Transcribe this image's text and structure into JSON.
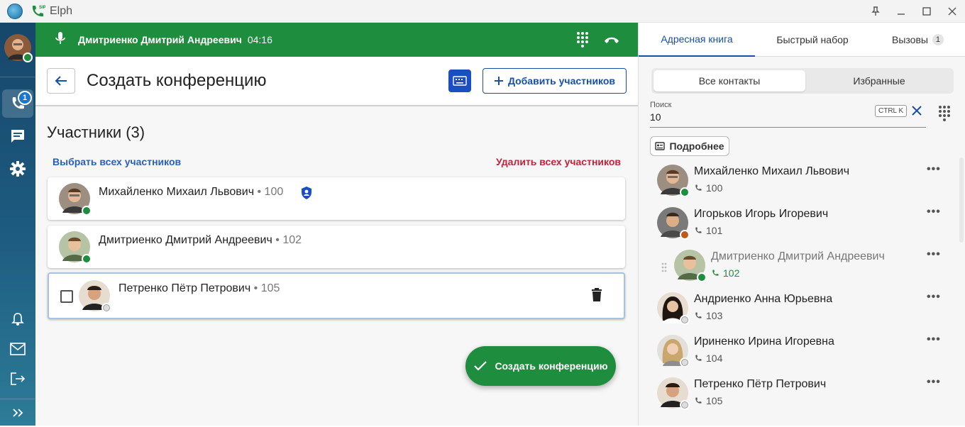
{
  "app": {
    "title": "Elph"
  },
  "rail": {
    "calls_badge": "1"
  },
  "call": {
    "caller": "Дмитриенко Дмитрий Андреевич",
    "timer": "04:16"
  },
  "header": {
    "title": "Создать конференцию",
    "add_label": "Добавить участников"
  },
  "participants": {
    "title": "Участники (3)",
    "select_all": "Выбрать всех участников",
    "delete_all": "Удалить всех участников",
    "items": [
      {
        "name": "Михайленко Михаил Львович",
        "sep": " • ",
        "ext": "100"
      },
      {
        "name": "Дмитриенко Дмитрий Андреевич",
        "sep": " • ",
        "ext": "102"
      },
      {
        "name": "Петренко Пётр Петрович",
        "sep": " • ",
        "ext": "105"
      }
    ]
  },
  "create_label": "Создать конференцию",
  "right": {
    "tabs": [
      {
        "label": "Адресная книга"
      },
      {
        "label": "Быстрый набор"
      },
      {
        "label": "Вызовы",
        "badge": "1"
      }
    ],
    "segments": [
      "Все контакты",
      "Избранные"
    ],
    "search": {
      "label": "Поиск",
      "value": "10",
      "shortcut": "CTRL K"
    },
    "more_label": "Подробнее",
    "contacts": [
      {
        "name": "Михайленко Михаил Львович",
        "phone": "100"
      },
      {
        "name": "Игорьков Игорь Игоревич",
        "phone": "101"
      },
      {
        "name": "Дмитриенко Дмитрий Андреевич",
        "phone": "102"
      },
      {
        "name": "Андриенко Анна Юрьевна",
        "phone": "103"
      },
      {
        "name": "Ириненко Ирина Игоревна",
        "phone": "104"
      },
      {
        "name": "Петренко Пётр Петрович",
        "phone": "105"
      }
    ]
  },
  "colors": {
    "green": "#1e8d3e",
    "blue": "#1a4fa3",
    "red": "#c4213a",
    "rail": "#1d5a7f"
  }
}
